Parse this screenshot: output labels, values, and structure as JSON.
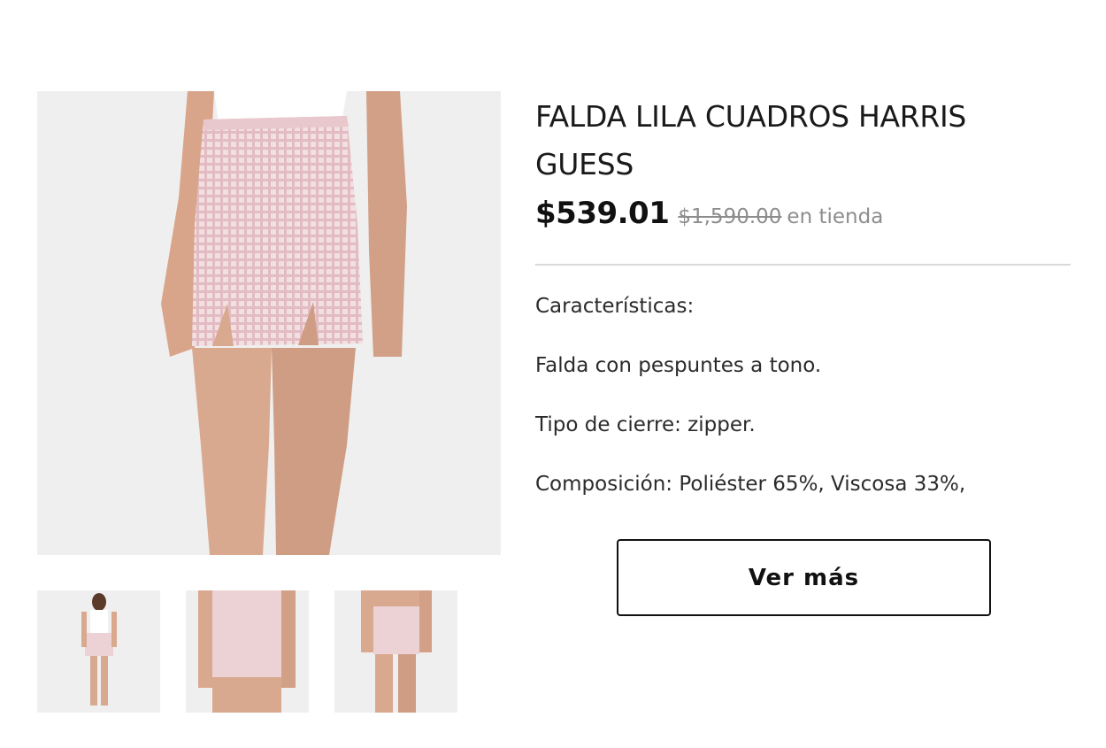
{
  "product": {
    "title": "FALDA LILA CUADROS HARRIS GUESS",
    "price": "$539.01",
    "old_price": "$1,590.00",
    "price_note": "en tienda"
  },
  "features": [
    "Características:",
    "Falda con pespuntes a tono.",
    "Tipo de cierre: zipper.",
    "Composición: Poliéster 65%, Viscosa 33%,"
  ],
  "actions": {
    "more_label": "Ver más"
  },
  "gallery": {
    "thumbnails": [
      "full-body-front",
      "skirt-closeup-front",
      "back-view"
    ]
  },
  "colors": {
    "image_background": "#efefef",
    "skirt_pink": "#ecd2d5",
    "skin": "#d9a88e",
    "muted_text": "#8d8d8d",
    "divider": "#d9d9d9"
  }
}
